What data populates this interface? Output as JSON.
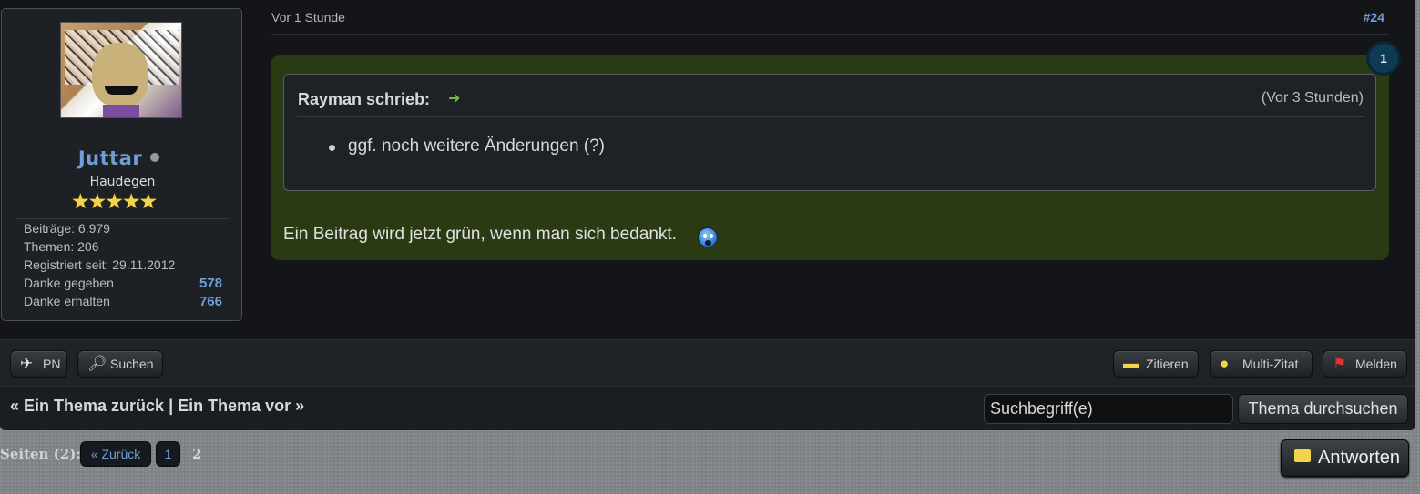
{
  "user": {
    "name": "Juttar",
    "rank": "Haudegen",
    "stars": "★★★★★",
    "stats": [
      {
        "label": "Beiträge: 6.979",
        "value": ""
      },
      {
        "label": "Themen: 206",
        "value": ""
      },
      {
        "label": "Registriert seit: 29.11.2012",
        "value": ""
      },
      {
        "label": "Danke gegeben",
        "value": "578"
      },
      {
        "label": "Danke erhalten",
        "value": "766"
      }
    ]
  },
  "post": {
    "time": "Vor 1 Stunde",
    "number": "#24",
    "thanks_count": "1",
    "quote": {
      "author": "Rayman schrieb:",
      "arrow": "➜",
      "time": "(Vor 3 Stunden)",
      "item": "ggf. noch weitere Änderungen (?)"
    },
    "text": "Ein Beitrag wird jetzt grün, wenn man sich bedankt."
  },
  "actions": {
    "pn": "PN",
    "search": "Suchen",
    "quote": "Zitieren",
    "multi_quote": "Multi-Zitat",
    "report": "Melden"
  },
  "nav": {
    "prev": "« Ein Thema zurück",
    "separator": "|",
    "next": "Ein Thema vor »",
    "search_placeholder": "Suchbegriff(e)",
    "search_button": "Thema durchsuchen"
  },
  "pagination": {
    "label": "Seiten (2):",
    "back": "« Zurück",
    "page1": "1",
    "page2": "2"
  },
  "reply": "Antworten",
  "colors": {
    "accent": "#6f9fd8",
    "post_bg_thanked": "#2a3a12"
  }
}
